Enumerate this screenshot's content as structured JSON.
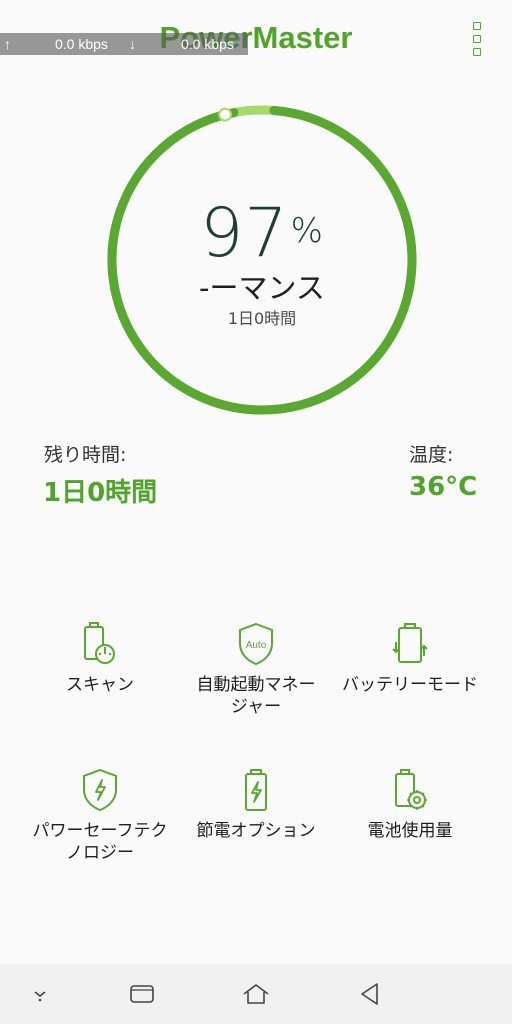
{
  "status_overlay": {
    "upload_arrow": "↑",
    "upload_speed": "0.0 kbps",
    "download_arrow": "↓",
    "download_speed": "0.0 kbps"
  },
  "app": {
    "title": "PowerMaster",
    "menu_icon": "more-vertical-icon"
  },
  "gauge": {
    "percent": "97",
    "percent_symbol": "%",
    "mode_text": "-ーマンス",
    "remaining_small": "1日0時間",
    "level_fraction": 0.97,
    "ring_color": "#5aa832",
    "ring_light_color": "#a6d86a",
    "stripe_colors": [
      "#8ccc5e",
      "#4ab0b6"
    ]
  },
  "info": {
    "remaining_label": "残り時間:",
    "remaining_value": "1日0時間",
    "temp_label": "温度:",
    "temp_value": "36°C"
  },
  "features": [
    {
      "label_lines": [
        "スキャン"
      ],
      "icon": "battery-speedometer-icon"
    },
    {
      "label_lines": [
        "自動起動マネー",
        "ジャー"
      ],
      "icon": "auto-shield-icon",
      "icon_text": "Auto"
    },
    {
      "label_lines": [
        "バッテリーモード"
      ],
      "icon": "battery-cycle-icon"
    },
    {
      "label_lines": [
        "パワーセーフテク",
        "ノロジー"
      ],
      "icon": "shield-bolt-icon"
    },
    {
      "label_lines": [
        "節電オプション"
      ],
      "icon": "battery-bolt-icon"
    },
    {
      "label_lines": [
        "電池使用量"
      ],
      "icon": "battery-gear-icon"
    }
  ],
  "navbar": {
    "items": [
      "chevron-down-icon",
      "recents-icon",
      "home-icon",
      "back-icon"
    ]
  },
  "colors": {
    "accent": "#4ea52a",
    "icon_green": "#5aa832"
  }
}
